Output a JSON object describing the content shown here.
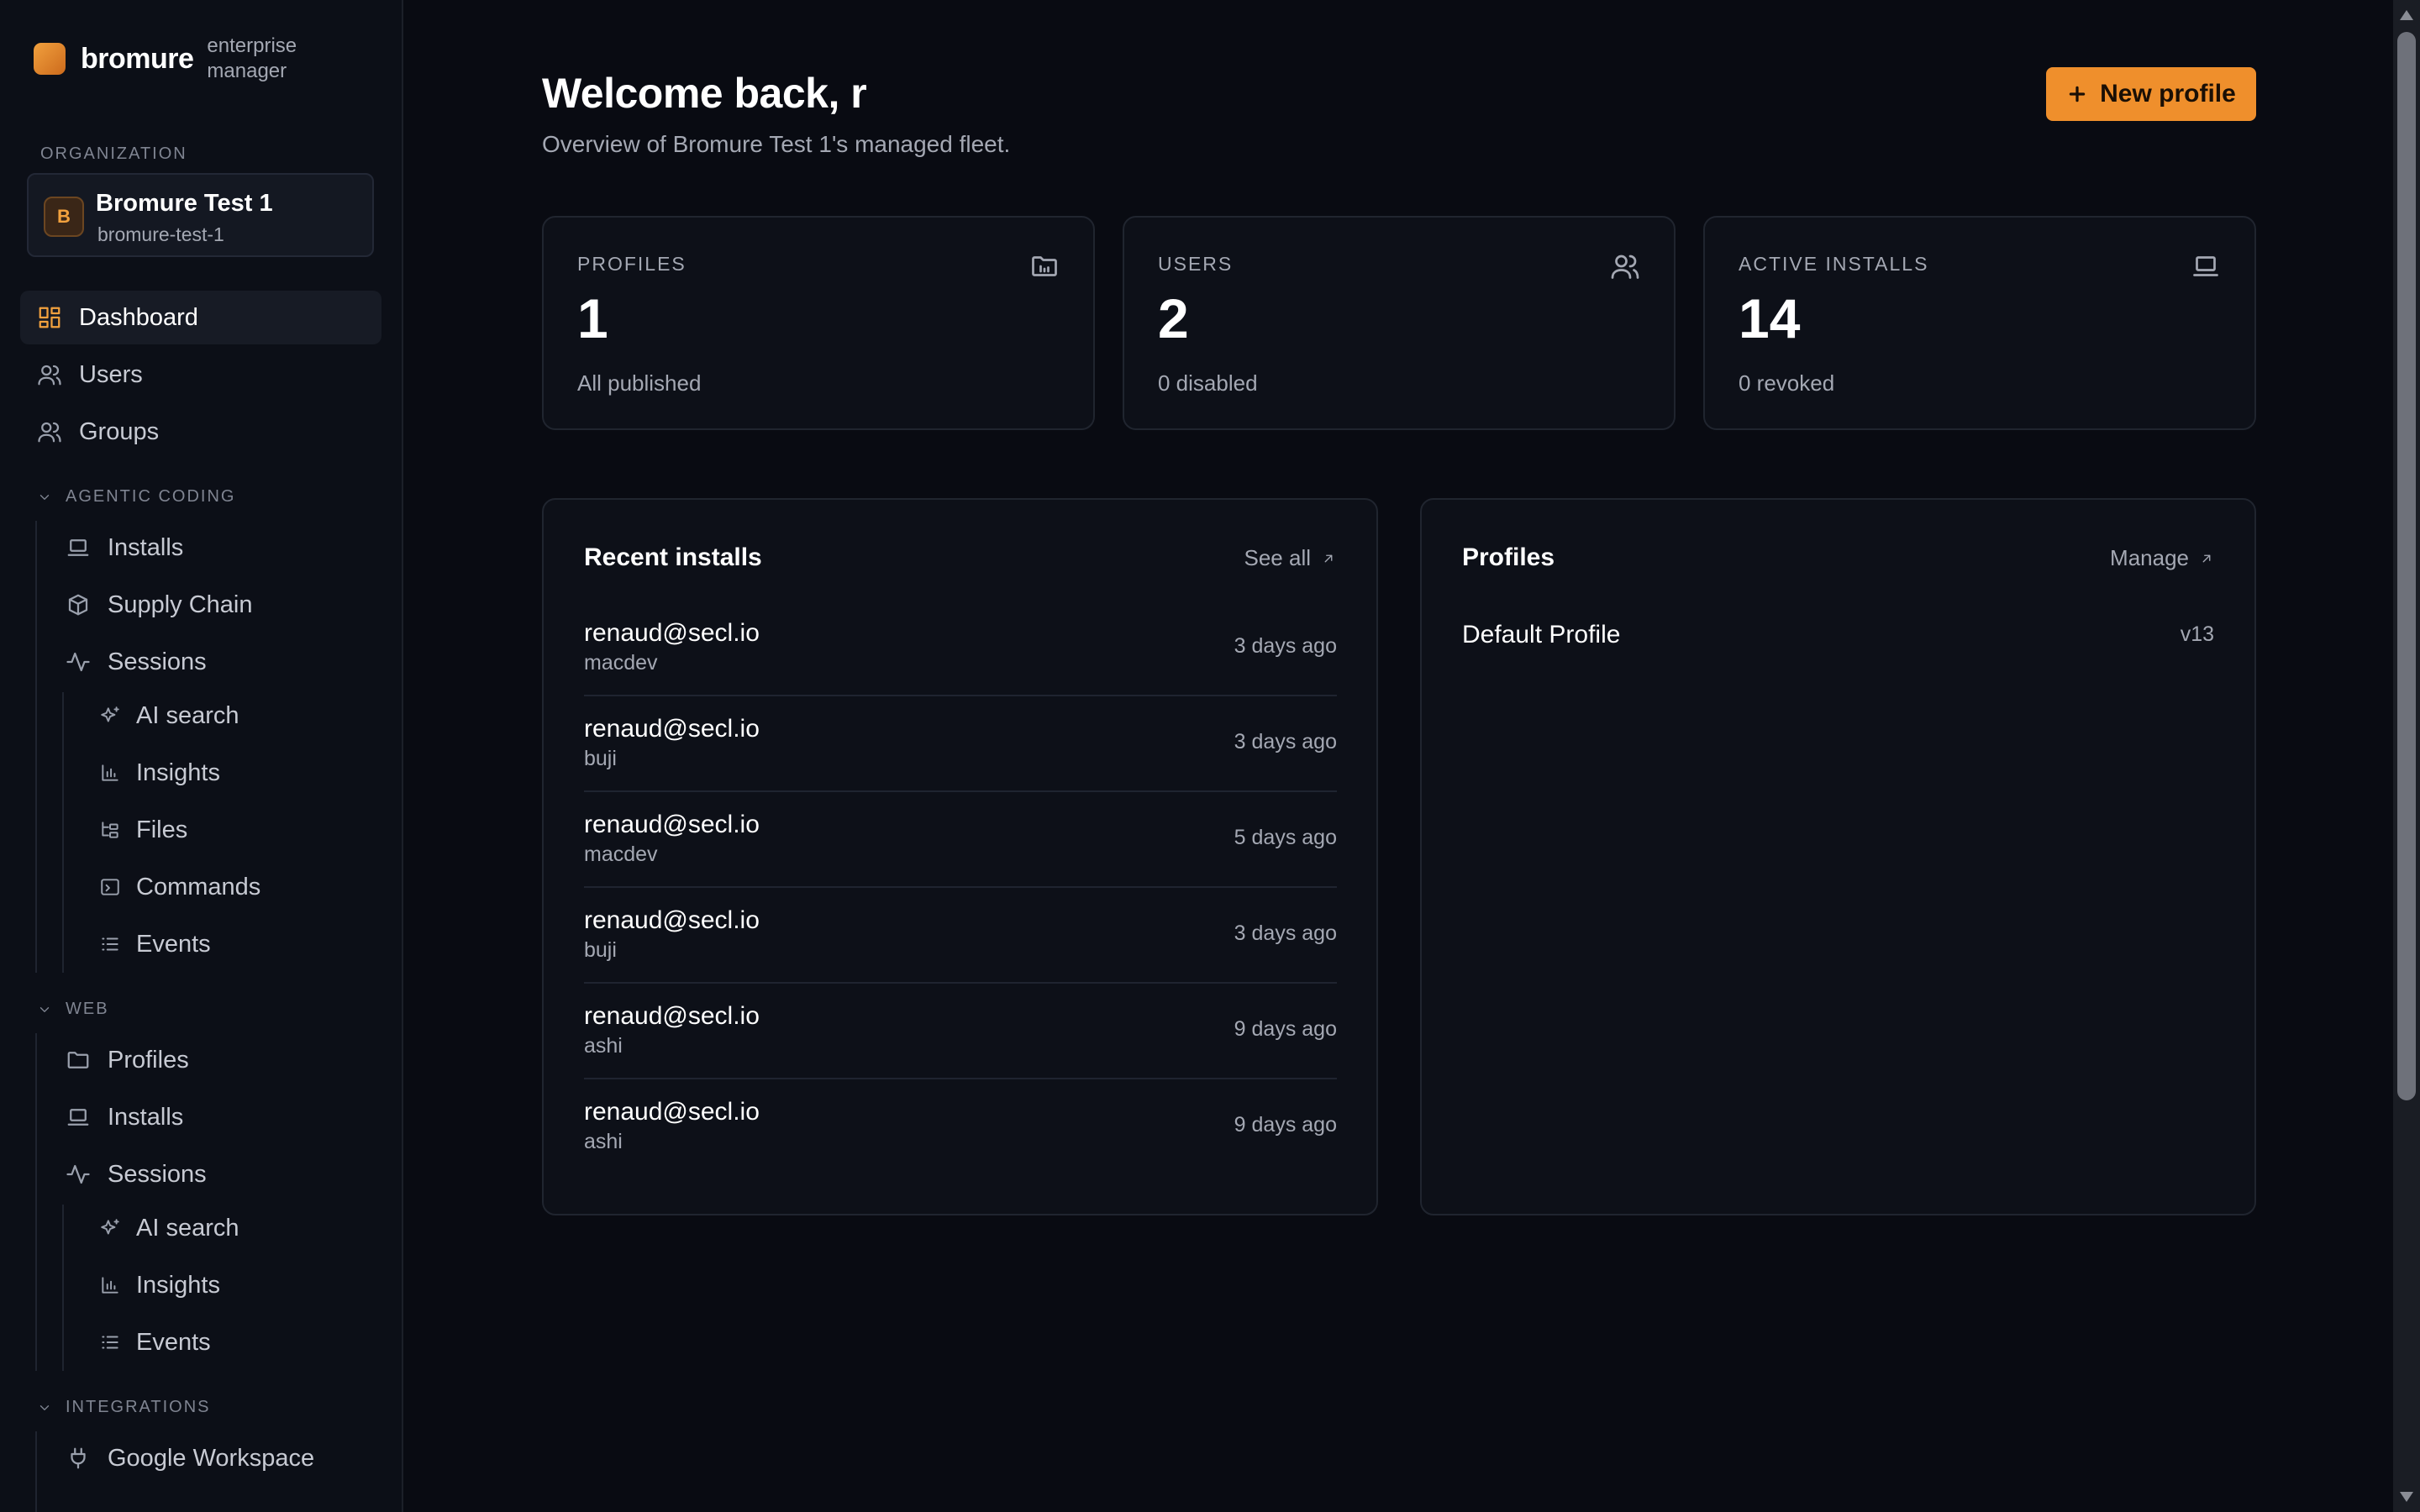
{
  "brand": {
    "name": "bromure",
    "subtitle": "enterprise manager"
  },
  "org": {
    "section_label": "ORGANIZATION",
    "avatar": "B",
    "name": "Bromure Test 1",
    "slug": "bromure-test-1"
  },
  "sidebar": {
    "top": [
      {
        "label": "Dashboard",
        "icon": "dashboard-icon",
        "active": true
      },
      {
        "label": "Users",
        "icon": "users-icon"
      },
      {
        "label": "Groups",
        "icon": "groups-icon"
      }
    ],
    "agentic": {
      "title": "AGENTIC CODING",
      "items": [
        "Installs",
        "Supply Chain",
        "Sessions"
      ],
      "sub": [
        "AI search",
        "Insights",
        "Files",
        "Commands",
        "Events"
      ]
    },
    "web": {
      "title": "WEB",
      "items": [
        "Profiles",
        "Installs",
        "Sessions"
      ],
      "sub": [
        "AI search",
        "Insights",
        "Events"
      ]
    },
    "integrations": {
      "title": "INTEGRATIONS",
      "items": [
        "Google Workspace"
      ]
    }
  },
  "header": {
    "title": "Welcome back, r",
    "subtitle": "Overview of Bromure Test 1's managed fleet.",
    "new_profile": "New profile"
  },
  "stats": [
    {
      "label": "PROFILES",
      "value": "1",
      "note": "All published",
      "icon": "folder-icon"
    },
    {
      "label": "USERS",
      "value": "2",
      "note": "0 disabled",
      "icon": "users-icon"
    },
    {
      "label": "ACTIVE INSTALLS",
      "value": "14",
      "note": "0 revoked",
      "icon": "laptop-icon"
    }
  ],
  "recent": {
    "title": "Recent installs",
    "link": "See all",
    "rows": [
      {
        "email": "renaud@secl.io",
        "host": "macdev",
        "time": "3 days ago"
      },
      {
        "email": "renaud@secl.io",
        "host": "buji",
        "time": "3 days ago"
      },
      {
        "email": "renaud@secl.io",
        "host": "macdev",
        "time": "5 days ago"
      },
      {
        "email": "renaud@secl.io",
        "host": "buji",
        "time": "3 days ago"
      },
      {
        "email": "renaud@secl.io",
        "host": "ashi",
        "time": "9 days ago"
      },
      {
        "email": "renaud@secl.io",
        "host": "ashi",
        "time": "9 days ago"
      }
    ]
  },
  "profiles": {
    "title": "Profiles",
    "link": "Manage",
    "rows": [
      {
        "name": "Default Profile",
        "version": "v13"
      }
    ]
  },
  "colors": {
    "accent": "#ef8f2c",
    "background": "#090b12",
    "panel": "#0d1018",
    "border": "#20252f"
  }
}
